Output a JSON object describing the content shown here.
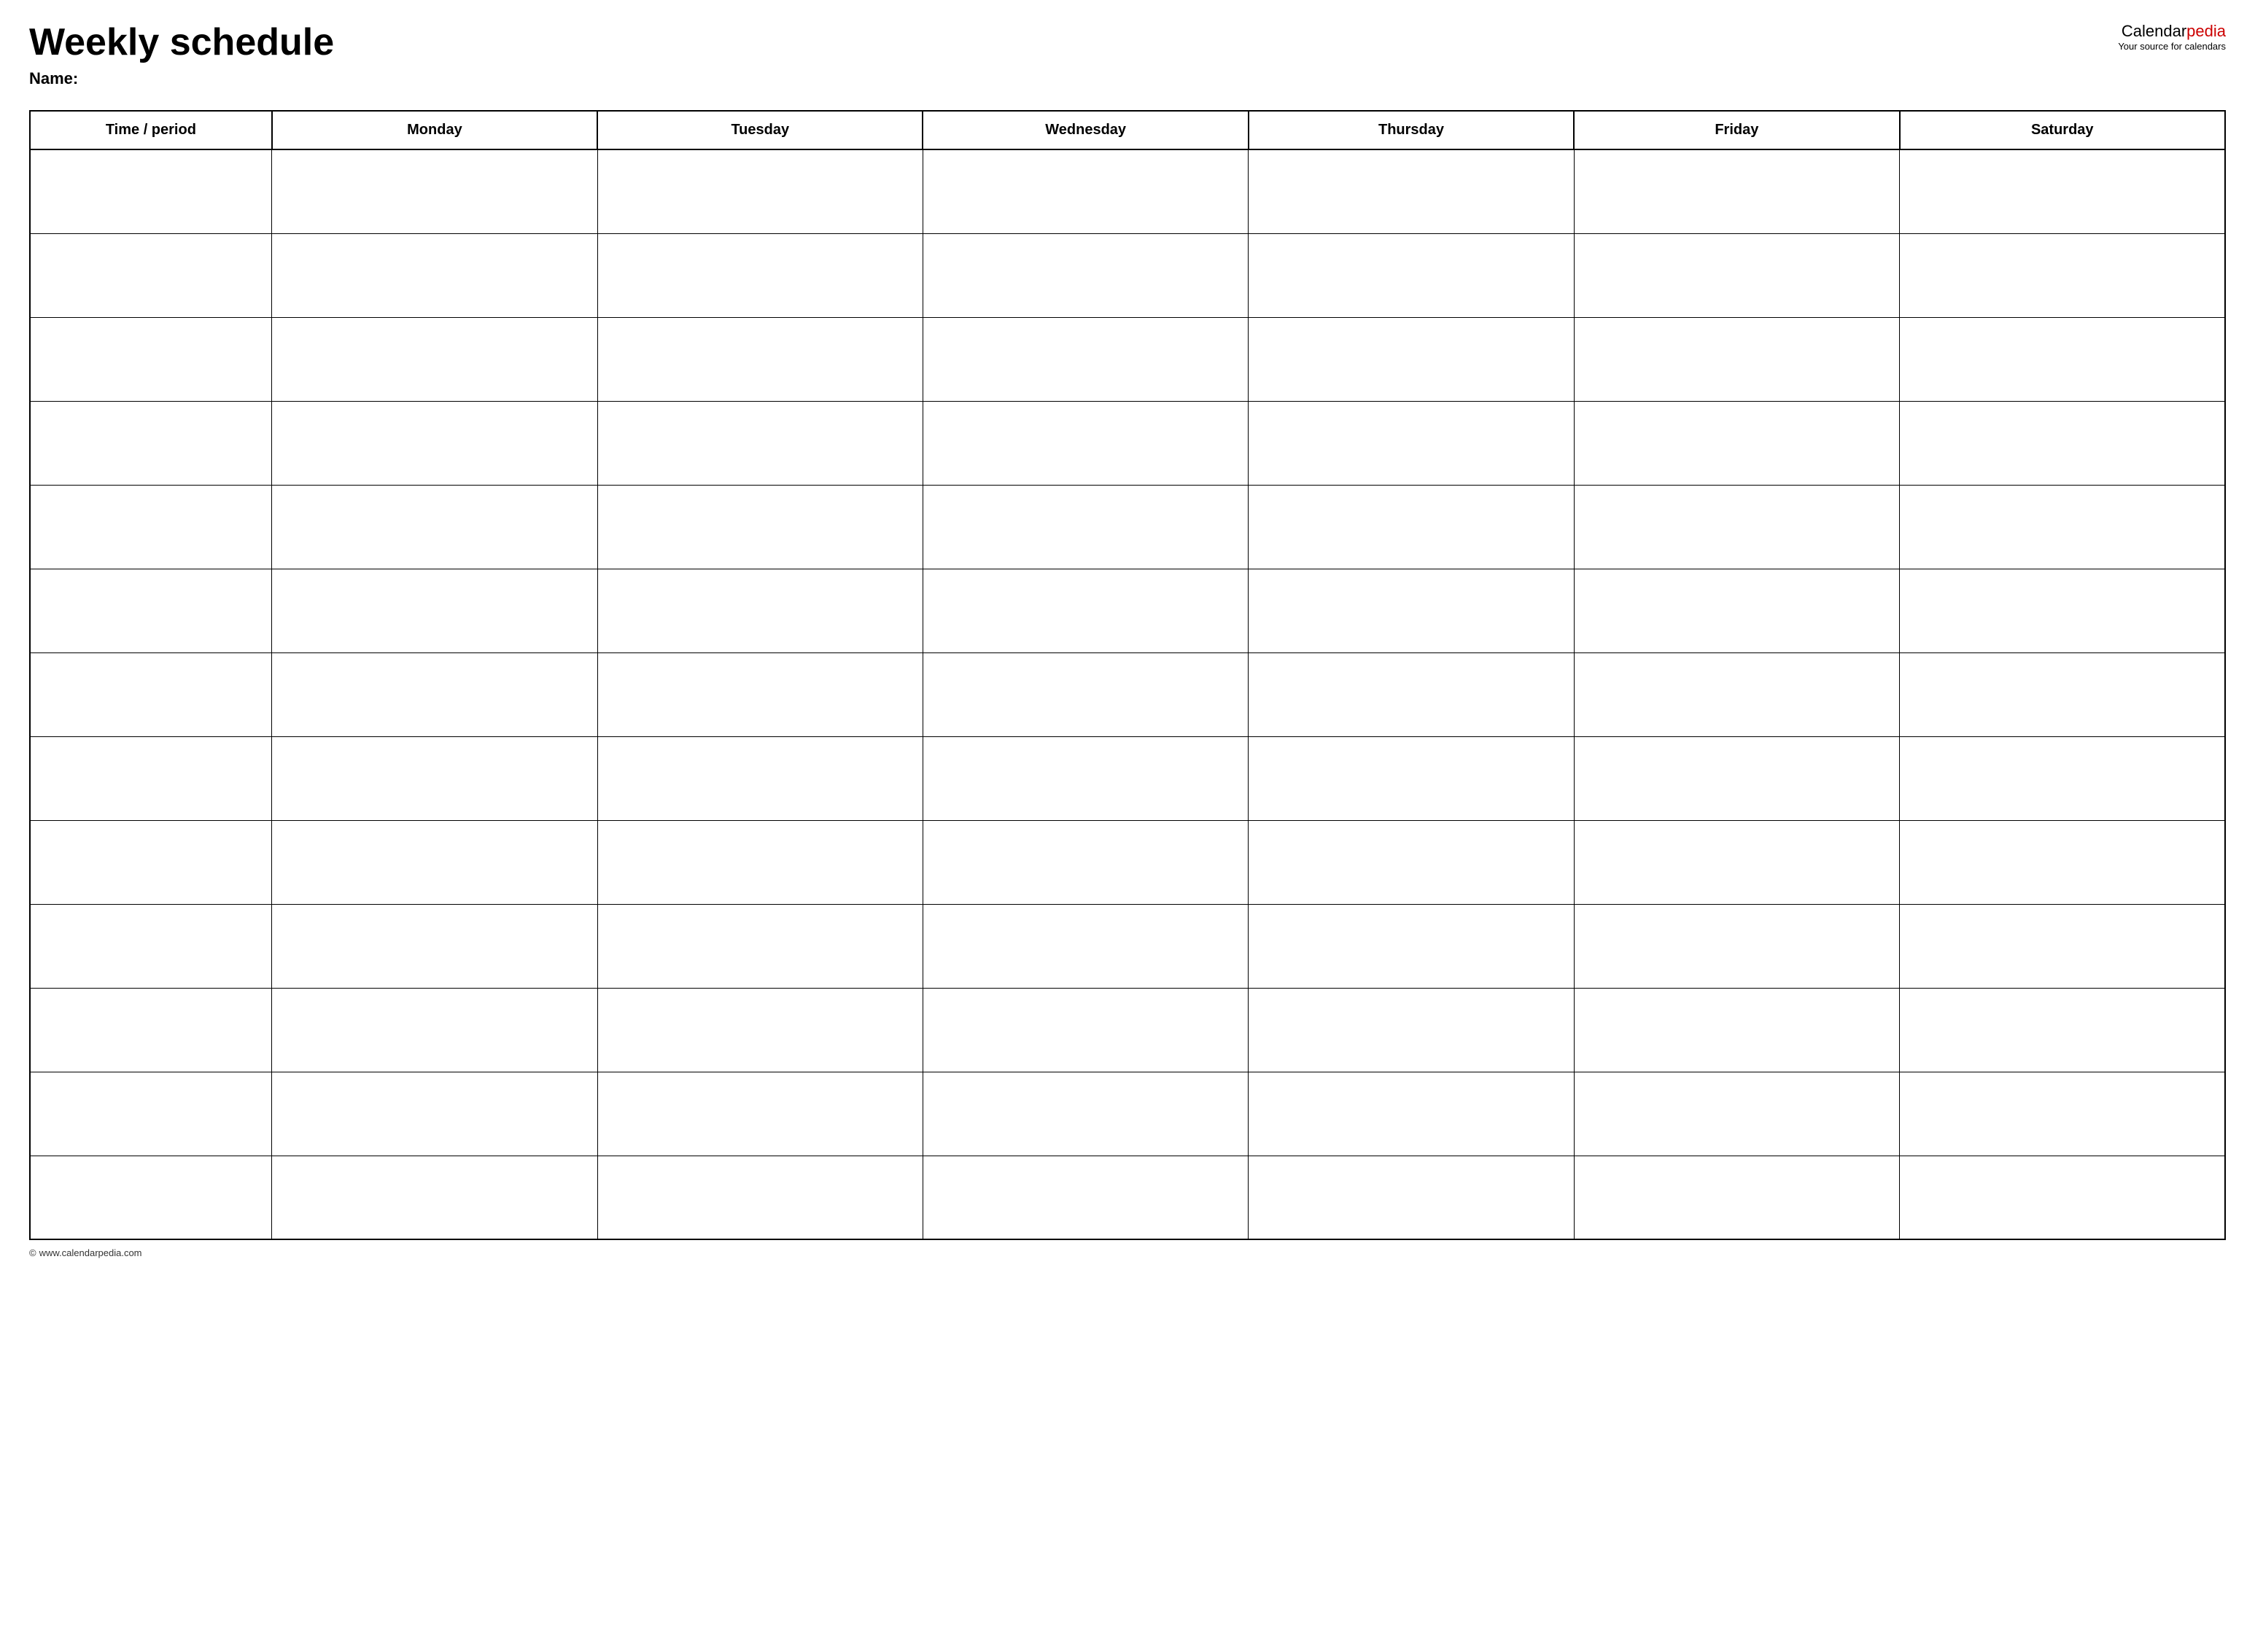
{
  "header": {
    "title": "Weekly schedule",
    "name_label": "Name:",
    "logo_calendar": "Calendar",
    "logo_pedia": "pedia",
    "logo_tagline": "Your source for calendars"
  },
  "table": {
    "columns": [
      {
        "label": "Time / period",
        "class": "time-col"
      },
      {
        "label": "Monday",
        "class": "day-col"
      },
      {
        "label": "Tuesday",
        "class": "day-col"
      },
      {
        "label": "Wednesday",
        "class": "day-col"
      },
      {
        "label": "Thursday",
        "class": "day-col"
      },
      {
        "label": "Friday",
        "class": "day-col"
      },
      {
        "label": "Saturday",
        "class": "day-col"
      }
    ],
    "row_count": 13
  },
  "footer": {
    "copyright": "© www.calendarpedia.com"
  }
}
